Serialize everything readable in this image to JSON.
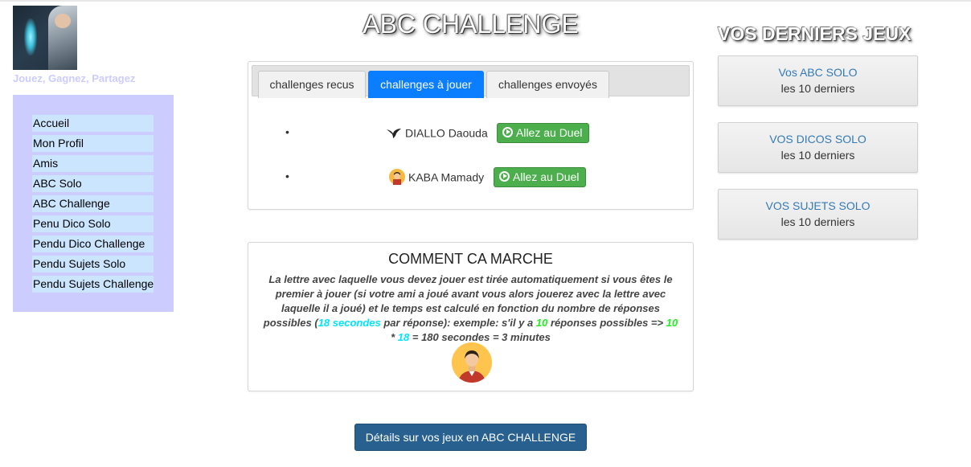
{
  "brand": {
    "tagline": "Jouez, Gagnez, Partagez"
  },
  "nav": [
    {
      "label": "Accueil"
    },
    {
      "label": "Mon Profil"
    },
    {
      "label": "Amis"
    },
    {
      "label": "ABC Solo"
    },
    {
      "label": "ABC Challenge"
    },
    {
      "label": "Penu Dico Solo"
    },
    {
      "label": "Pendu Dico Challenge"
    },
    {
      "label": "Pendu Sujets Solo"
    },
    {
      "label": "Pendu Sujets Challenge"
    }
  ],
  "main": {
    "title": "ABC CHALLENGE",
    "tabs": [
      {
        "label": "challenges recus",
        "active": false
      },
      {
        "label": "challenges à jouer",
        "active": true
      },
      {
        "label": "challenges envoyés",
        "active": false
      }
    ],
    "duels": [
      {
        "player": "DIALLO Daouda",
        "icon": "bird-icon",
        "button": "Allez au Duel"
      },
      {
        "player": "KABA Mamady",
        "icon": "user-avatar-icon",
        "button": "Allez au Duel"
      }
    ],
    "how": {
      "title": "COMMENT CA MARCHE",
      "text_1": "La lettre avec laquelle vous devez jouer est tirée automatiquement si vous êtes le premier à jouer (si votre ami a joué avant vous alors jouerez avec la lettre avec laquelle il a joué) et le temps est calculé en fonction du nombre de réponses possibles (",
      "seconds_per_answer": "18 secondes",
      "text_2": " par réponse): exemple: s'il y a ",
      "answers": "10",
      "text_3": " réponses possibles => ",
      "formula_a": "10",
      "formula_op": " * ",
      "formula_b": "18",
      "formula_result": " = 180 secondes = 3 minutes"
    },
    "details_button": "Détails sur vos jeux en ABC CHALLENGE"
  },
  "sidebar": {
    "title": "VOS DERNIERS JEUX",
    "games": [
      {
        "link": "Vos ABC SOLO",
        "sub": "les 10 derniers"
      },
      {
        "link": "VOS DICOS SOLO",
        "sub": "les 10 derniers"
      },
      {
        "link": "VOS SUJETS SOLO",
        "sub": "les 10 derniers"
      }
    ]
  },
  "colors": {
    "nav_bg": "#ccccff",
    "nav_item_bg": "#cce5ff",
    "tab_active": "#0b7dff",
    "duel_button": "#4cae4c",
    "details_button": "#286090",
    "highlight_cyan": "#00e5ff",
    "highlight_green": "#22ee22"
  }
}
